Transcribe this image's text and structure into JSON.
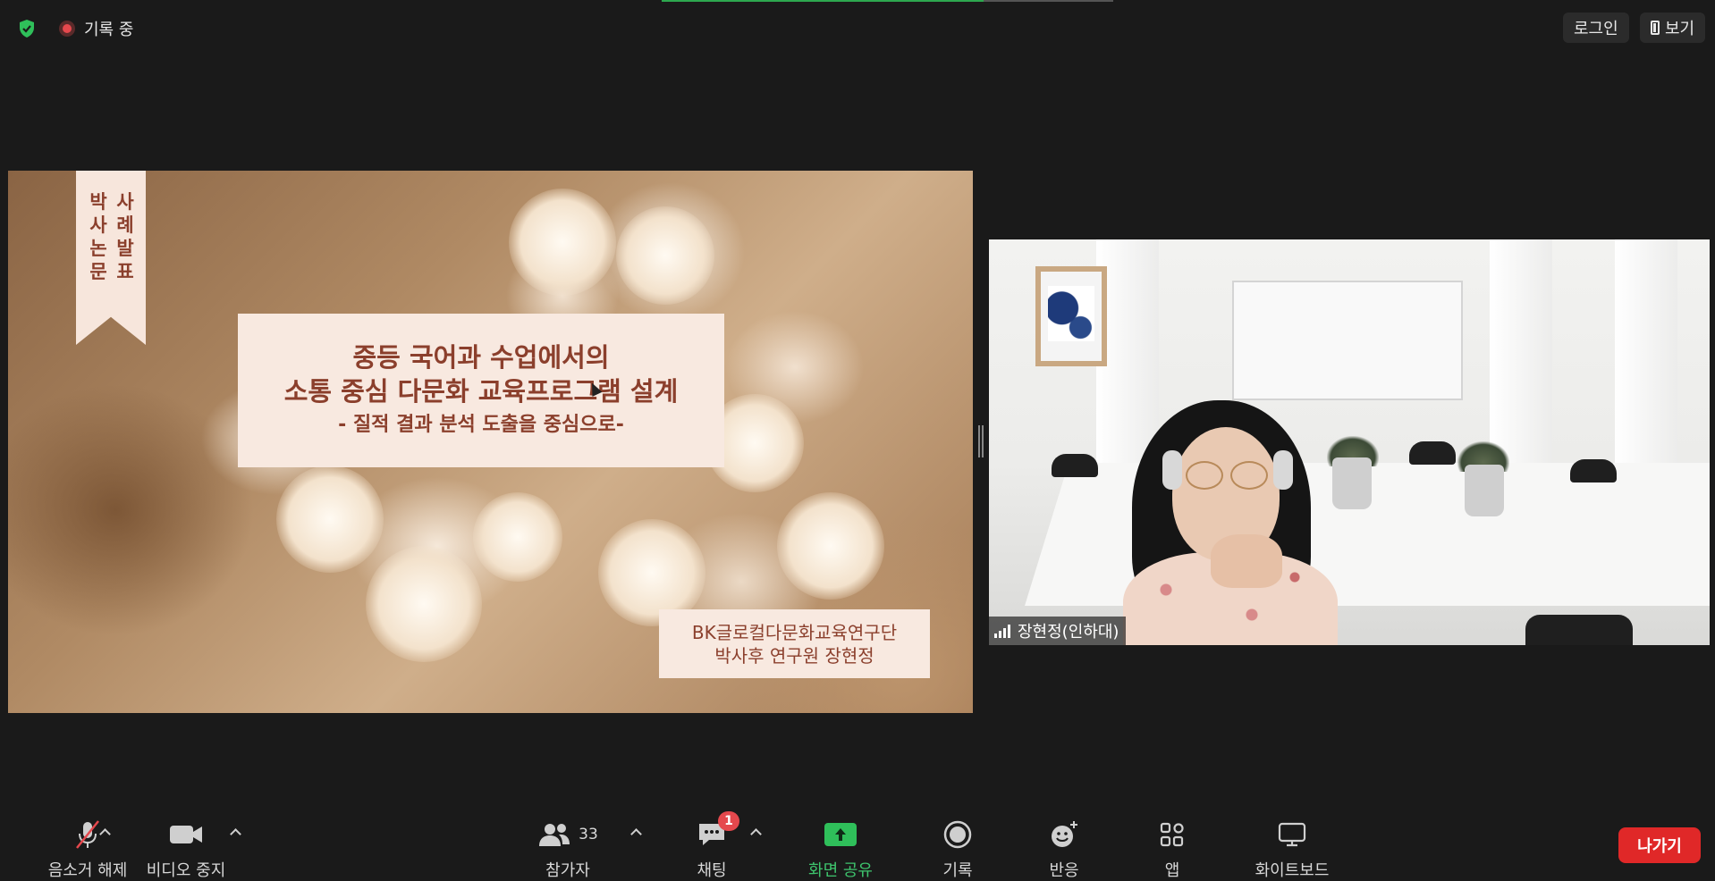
{
  "header": {
    "recording_label": "기록 중",
    "login_label": "로그인",
    "view_label": "보기"
  },
  "slide": {
    "ribbon_text": [
      "박사논문",
      "사례발표"
    ],
    "title_line1": "중등 국어과 수업에서의",
    "title_line2": "소통 중심 다문화 교육프로그램 설계",
    "subtitle": "- 질적 결과 분석 도출을 중심으로-",
    "author_line1": "BK글로컬다문화교육연구단",
    "author_line2": "박사후 연구원 장현정"
  },
  "video": {
    "participant_name": "장현정(인하대)"
  },
  "toolbar": {
    "mute_label": "음소거 해제",
    "video_label": "비디오 중지",
    "participants_label": "참가자",
    "participants_count": "33",
    "chat_label": "채팅",
    "chat_badge": "1",
    "share_label": "화면 공유",
    "record_label": "기록",
    "reactions_label": "반응",
    "apps_label": "앱",
    "whiteboard_label": "화이트보드",
    "leave_label": "나가기"
  },
  "colors": {
    "background": "#1a1a1a",
    "share_green": "#2fbf5a",
    "leave_red": "#e02828",
    "slide_text": "#8b3f2c",
    "slide_box": "#f8e9e0"
  }
}
